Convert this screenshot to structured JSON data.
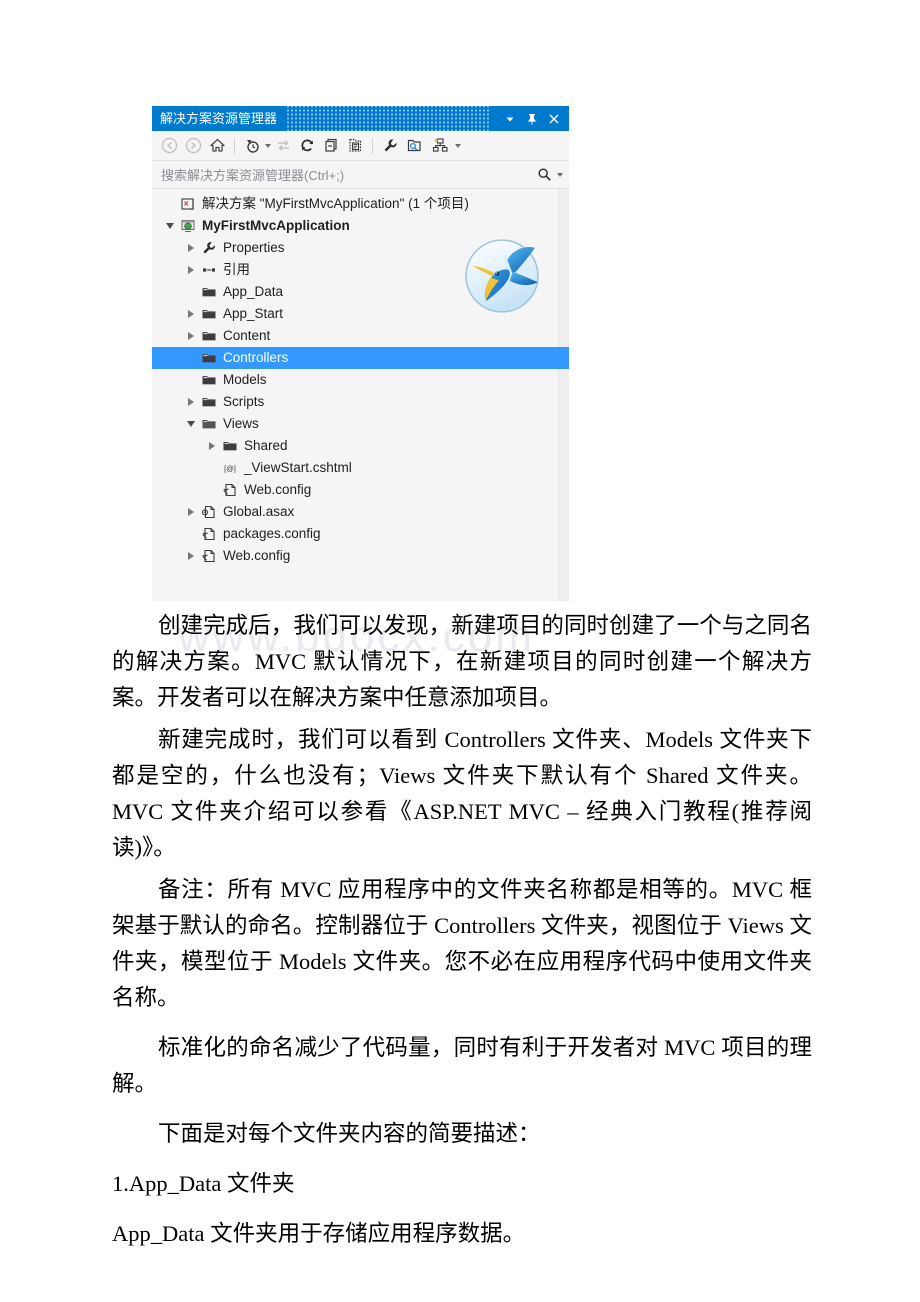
{
  "watermark": "www.bdocx.com",
  "solution_explorer": {
    "title": "解决方案资源管理器",
    "titlebar_buttons": [
      {
        "name": "window-menu-dropdown",
        "icon": "chevron-down-icon"
      },
      {
        "name": "auto-hide-pin",
        "icon": "pin-icon"
      },
      {
        "name": "close-window",
        "icon": "close-icon"
      }
    ],
    "toolbar": [
      {
        "name": "back-button",
        "icon": "back-arrow-icon",
        "label": "后退"
      },
      {
        "name": "forward-button",
        "icon": "forward-arrow-icon",
        "label": "前进"
      },
      {
        "name": "home-button",
        "icon": "home-icon",
        "label": "主页"
      },
      {
        "name": "pending-changes-button",
        "icon": "pending-changes-icon",
        "label": "挂起的更改筛选器"
      },
      {
        "name": "sync-with-active-document-button",
        "icon": "sync-arrows-icon",
        "label": "与活动文档同步"
      },
      {
        "name": "refresh-button",
        "icon": "refresh-icon",
        "label": "刷新"
      },
      {
        "name": "collapse-all-button",
        "icon": "collapse-all-icon",
        "label": "全部折叠"
      },
      {
        "name": "show-all-files-button",
        "icon": "show-all-files-icon",
        "label": "显示所有文件"
      },
      {
        "name": "properties-button",
        "icon": "wrench-icon",
        "label": "属性"
      },
      {
        "name": "preview-selected-items-button",
        "icon": "preview-folder-icon",
        "label": "预览选定项"
      },
      {
        "name": "view-class-diagram-button",
        "icon": "hierarchy-icon",
        "label": "查看类关系图"
      },
      {
        "name": "toolbar-overflow-button",
        "icon": "chevron-down-icon",
        "label": "更多"
      }
    ],
    "search": {
      "placeholder": "搜索解决方案资源管理器(Ctrl+;)",
      "value": "",
      "icon": "search-icon",
      "dropdown_icon": "chevron-down-icon"
    },
    "tree": [
      {
        "label": "解决方案 \"MyFirstMvcApplication\" (1 个项目)",
        "icon": "solution-icon",
        "indent": 0,
        "expander": "none",
        "bold": false,
        "selected": false
      },
      {
        "label": "MyFirstMvcApplication",
        "icon": "web-project-icon",
        "indent": 0,
        "expander": "open",
        "bold": true,
        "selected": false
      },
      {
        "label": "Properties",
        "icon": "wrench-icon",
        "indent": 1,
        "expander": "closed",
        "bold": false,
        "selected": false
      },
      {
        "label": "引用",
        "icon": "references-icon",
        "indent": 1,
        "expander": "closed",
        "bold": false,
        "selected": false
      },
      {
        "label": "App_Data",
        "icon": "folder-icon",
        "indent": 1,
        "expander": "none",
        "bold": false,
        "selected": false
      },
      {
        "label": "App_Start",
        "icon": "folder-icon",
        "indent": 1,
        "expander": "closed",
        "bold": false,
        "selected": false
      },
      {
        "label": "Content",
        "icon": "folder-icon",
        "indent": 1,
        "expander": "closed",
        "bold": false,
        "selected": false
      },
      {
        "label": "Controllers",
        "icon": "folder-icon",
        "indent": 1,
        "expander": "none",
        "bold": false,
        "selected": true
      },
      {
        "label": "Models",
        "icon": "folder-icon",
        "indent": 1,
        "expander": "none",
        "bold": false,
        "selected": false
      },
      {
        "label": "Scripts",
        "icon": "folder-icon",
        "indent": 1,
        "expander": "closed",
        "bold": false,
        "selected": false
      },
      {
        "label": "Views",
        "icon": "folder-open-icon",
        "indent": 1,
        "expander": "open",
        "bold": false,
        "selected": false
      },
      {
        "label": "Shared",
        "icon": "folder-icon",
        "indent": 2,
        "expander": "closed",
        "bold": false,
        "selected": false
      },
      {
        "label": "_ViewStart.cshtml",
        "icon": "razor-view-icon",
        "indent": 2,
        "expander": "none",
        "bold": false,
        "selected": false
      },
      {
        "label": "Web.config",
        "icon": "config-file-icon",
        "indent": 2,
        "expander": "none",
        "bold": false,
        "selected": false
      },
      {
        "label": "Global.asax",
        "icon": "global-asax-icon",
        "indent": 1,
        "expander": "closed",
        "bold": false,
        "selected": false
      },
      {
        "label": "packages.config",
        "icon": "config-file-icon",
        "indent": 1,
        "expander": "none",
        "bold": false,
        "selected": false
      },
      {
        "label": "Web.config",
        "icon": "config-file-icon",
        "indent": 1,
        "expander": "closed",
        "bold": false,
        "selected": false
      }
    ],
    "logo": "hummingbird-icon",
    "colors": {
      "titlebar": "#007acc",
      "selection": "#3399ff",
      "panel_background": "#f5f5f5"
    }
  },
  "document": {
    "paragraphs": [
      {
        "text": "创建完成后，我们可以发现，新建项目的同时创建了一个与之同名的解决方案。MVC 默认情况下，在新建项目的同时创建一个解决方案。开发者可以在解决方案中任意添加项目。",
        "indent": true
      },
      {
        "text": "新建完成时，我们可以看到 Controllers 文件夹、Models 文件夹下都是空的，什么也没有；Views 文件夹下默认有个 Shared 文件夹。MVC 文件夹介绍可以参看《ASP.NET MVC – 经典入门教程(推荐阅读)》。",
        "indent": true
      },
      {
        "text": "备注：所有 MVC 应用程序中的文件夹名称都是相等的。MVC 框架基于默认的命名。控制器位于 Controllers 文件夹，视图位于 Views 文件夹，模型位于 Models 文件夹。您不必在应用程序代码中使用文件夹名称。",
        "indent": true
      },
      {
        "text": "标准化的命名减少了代码量，同时有利于开发者对 MVC 项目的理解。",
        "indent": true
      },
      {
        "text": "下面是对每个文件夹内容的简要描述：",
        "indent": true
      },
      {
        "text": "1.App_Data 文件夹",
        "indent": false
      },
      {
        "text": "App_Data 文件夹用于存储应用程序数据。",
        "indent": false
      }
    ]
  }
}
